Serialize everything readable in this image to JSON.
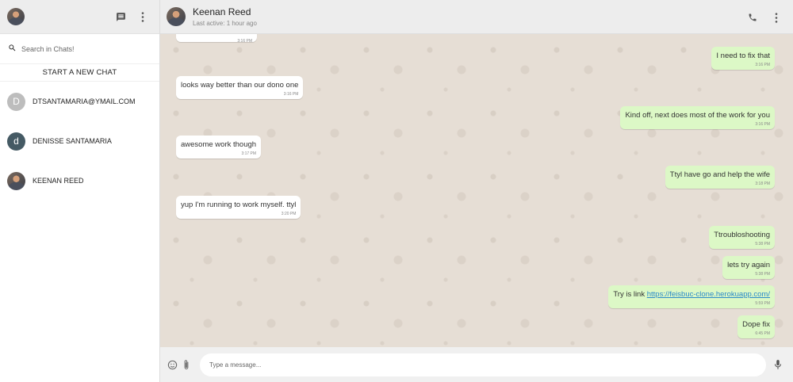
{
  "sidebar": {
    "search_placeholder": "Search in Chats!",
    "new_chat_label": "START A NEW CHAT",
    "chats": [
      {
        "initial": "D",
        "name": "DTSANTAMARIA@YMAIL.COM",
        "avatar_color": "#bdbdbd"
      },
      {
        "initial": "d",
        "name": "DENISSE SANTAMARIA",
        "avatar_color": "#455a64"
      },
      {
        "initial": "",
        "name": "KEENAN REED",
        "avatar_color": "photo"
      }
    ]
  },
  "chat": {
    "contact_name": "Keenan Reed",
    "status": "Last active: 1 hour ago",
    "composer_placeholder": "Type a message...",
    "messages": [
      {
        "direction": "in",
        "text": "",
        "time": "3:16 PM"
      },
      {
        "direction": "out",
        "text": "I need to fix that",
        "time": "3:16 PM"
      },
      {
        "direction": "in",
        "text": "looks way better than our dono one",
        "time": "3:16 PM"
      },
      {
        "direction": "out",
        "text": "Kind off, next does most of the work for you",
        "time": "3:16 PM"
      },
      {
        "direction": "in",
        "text": "awesome work though",
        "time": "3:17 PM"
      },
      {
        "direction": "out",
        "text": "Ttyl have go and help the wife",
        "time": "3:18 PM"
      },
      {
        "direction": "in",
        "text": "yup I'm running to work myself. ttyl",
        "time": "3:20 PM"
      },
      {
        "direction": "out",
        "text": "Ttroubloshooting",
        "time": "5:38 PM"
      },
      {
        "direction": "out",
        "text": "lets try again",
        "time": "5:38 PM"
      },
      {
        "direction": "out",
        "text_prefix": "Try is link ",
        "link": "https://feisbuc-clone.herokuapp.com/",
        "time": "5:59 PM"
      },
      {
        "direction": "out",
        "text": "Dope fix",
        "time": "6:45 PM"
      }
    ]
  },
  "colors": {
    "header_bg": "#ededed",
    "chat_bg": "#e6ded5",
    "outgoing_bubble": "#dcf8c6",
    "incoming_bubble": "#ffffff",
    "link": "#2a8ac9"
  }
}
